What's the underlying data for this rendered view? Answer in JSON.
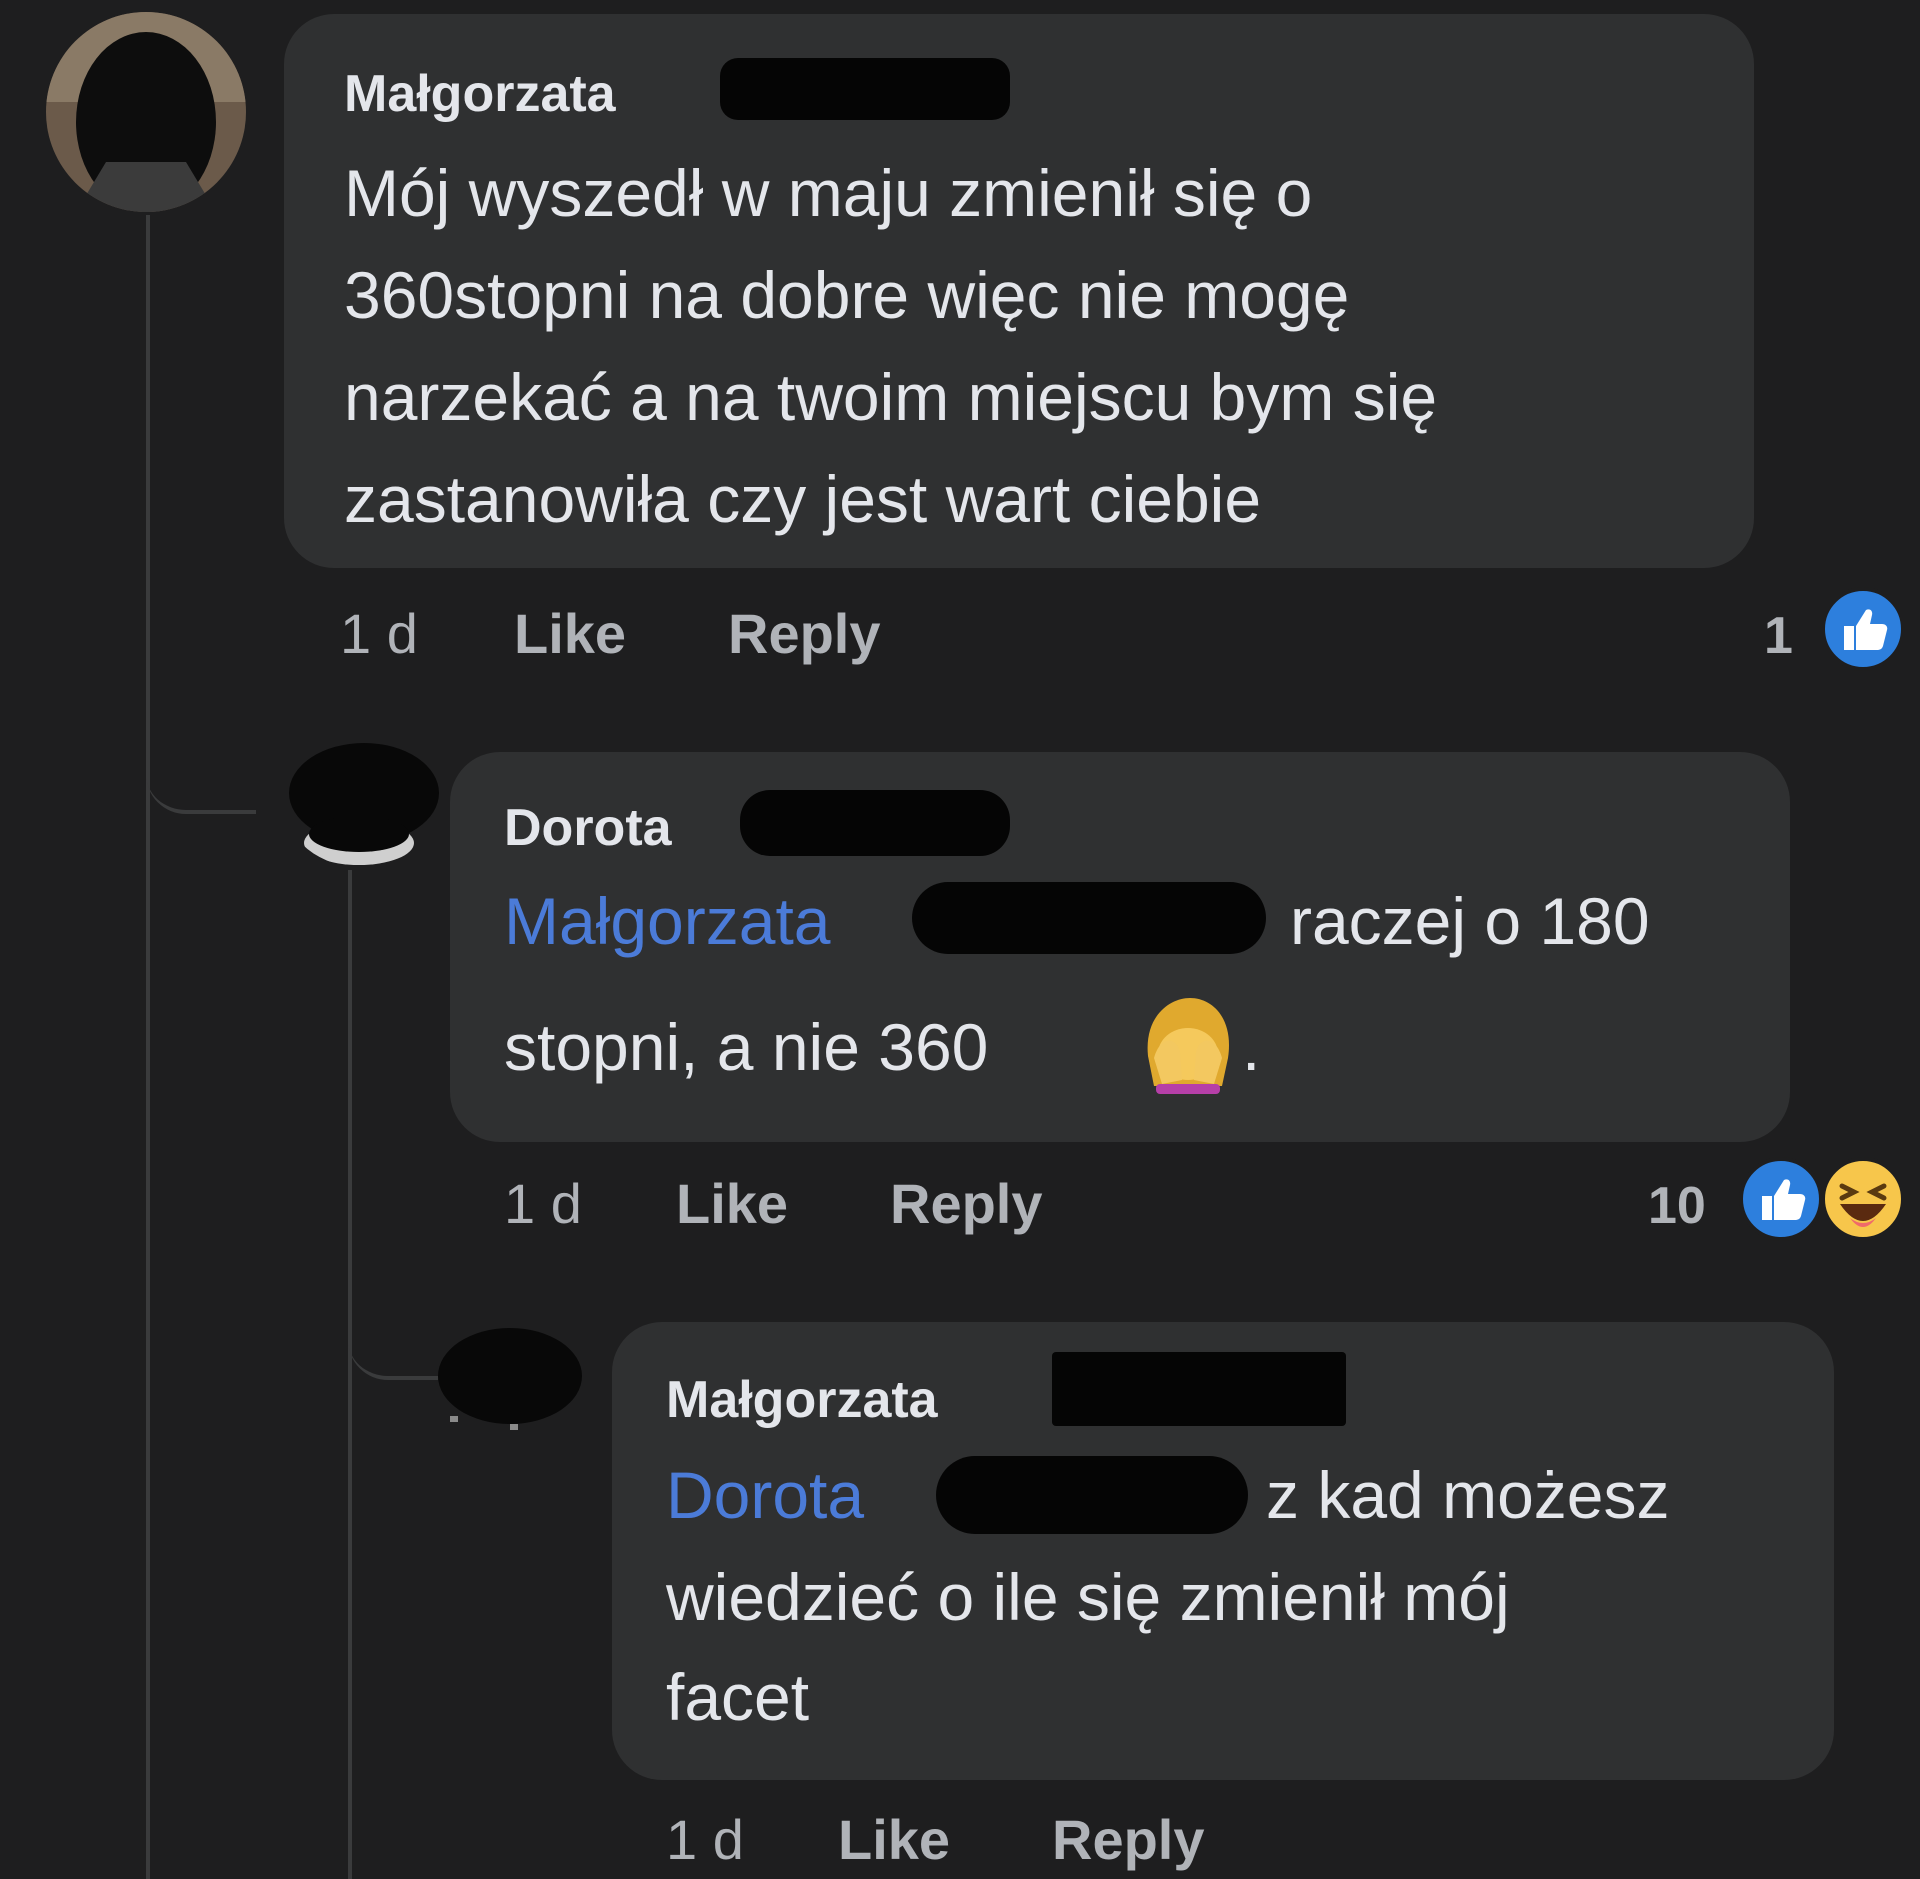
{
  "comments": [
    {
      "author": "Małgorzata",
      "lines": [
        "Mój wyszedł w maju zmienił się o",
        "360stopni na dobre więc nie mogę",
        "narzekać a na twoim miejscu bym się",
        "zastanowiła czy  jest wart ciebie"
      ],
      "time": "1 d",
      "like_label": "Like",
      "reply_label": "Reply",
      "reaction_count": "1",
      "reaction_icons": [
        "like-icon"
      ]
    },
    {
      "author": "Dorota",
      "mention": "Małgorzata",
      "line1_rest": "raczej o 180",
      "line2": "stopni, a nie 360",
      "line2_after_emoji": ".",
      "emoji": "face-palm-woman-emoji",
      "time": "1 d",
      "like_label": "Like",
      "reply_label": "Reply",
      "reaction_count": "10",
      "reaction_icons": [
        "like-icon",
        "haha-icon"
      ]
    },
    {
      "author": "Małgorzata",
      "mention": "Dorota",
      "line1_rest": "z kad możesz",
      "lines": [
        "wiedzieć o ile się zmienił mój",
        "facet"
      ],
      "time": "1 d",
      "like_label": "Like",
      "reply_label": "Reply"
    }
  ],
  "colors": {
    "background": "#1e1e1f",
    "bubble": "#2f3031",
    "mention": "#4b7bd8",
    "like_blue": "#2d88ff",
    "haha_yellow": "#f7c64b"
  }
}
